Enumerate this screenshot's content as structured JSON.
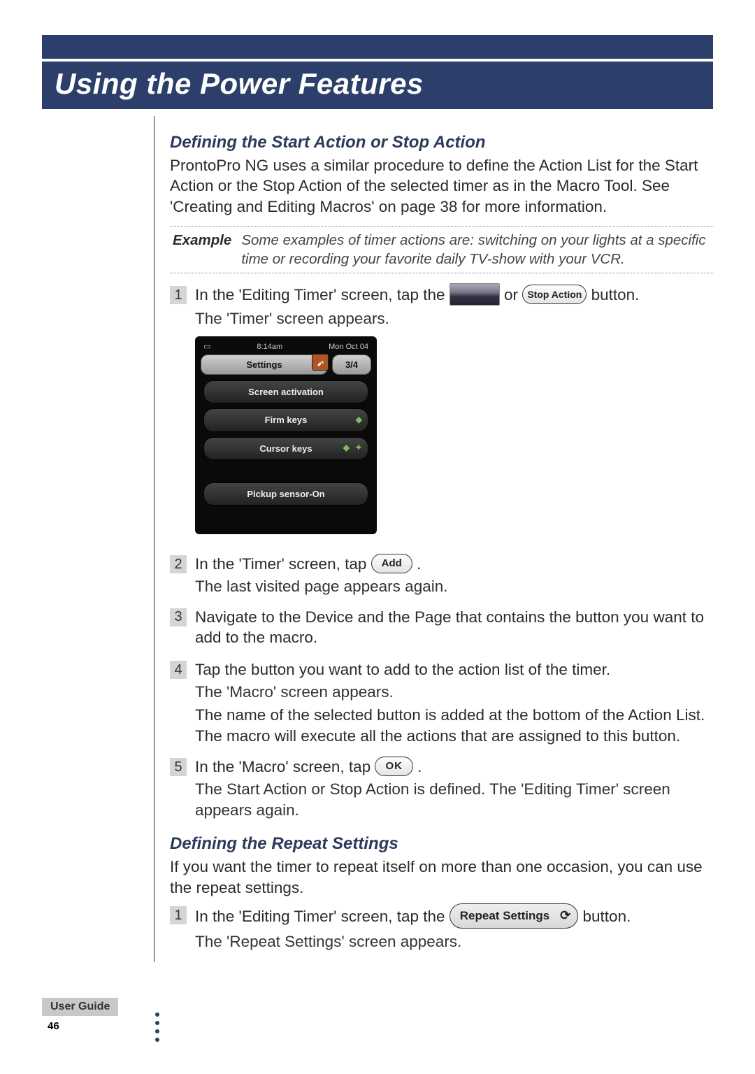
{
  "chapter_title": "Using the Power Features",
  "section1": {
    "heading": "Defining the Start Action or Stop Action",
    "intro": "ProntoPro NG uses a similar procedure to define the Action List for the Start Action or the Stop Action of the selected timer as in the Macro Tool. See 'Creating and Editing Macros' on page 38 for more information."
  },
  "example": {
    "label": "Example",
    "text": "Some examples of timer actions are: switching on your lights at a specific time or recording your favorite daily TV-show with your VCR."
  },
  "steps_a": [
    {
      "num": "1",
      "action_pre": "In the 'Editing Timer' screen, tap the ",
      "mid_or": " or ",
      "action_post": " button.",
      "stop_label": "Stop Action",
      "result": "The 'Timer' screen appears."
    },
    {
      "num": "2",
      "action_pre": "In the 'Timer' screen, tap ",
      "btn_label": "Add",
      "action_post": ".",
      "result": "The last visited page appears again."
    },
    {
      "num": "3",
      "action": "Navigate to the Device and the Page that contains the button you want to add to the macro."
    },
    {
      "num": "4",
      "action": "Tap the button you want to add to the action list of the timer.",
      "result": "The 'Macro' screen appears.",
      "followup": "The name of the selected button is added at the bottom of the Action List. The macro will execute all the actions that are assigned to this button."
    },
    {
      "num": "5",
      "action_pre": "In the 'Macro' screen, tap ",
      "btn_label": "OK",
      "action_post": ".",
      "result": "The Start Action or Stop Action is defined. The 'Editing Timer' screen appears again."
    }
  ],
  "section2": {
    "heading": "Defining the Repeat Settings",
    "intro": "If you want the timer to repeat itself on more than one occasion, you can use the repeat settings."
  },
  "steps_b": [
    {
      "num": "1",
      "action_pre": "In the 'Editing Timer' screen, tap the ",
      "btn_label": "Repeat Settings",
      "action_post": " button.",
      "result": "The 'Repeat Settings' screen appears."
    }
  ],
  "device_shot": {
    "status_left": "8:14am",
    "status_right": "Mon Oct 04",
    "tab_left": "Settings",
    "tab_right": "3/4",
    "rows": [
      "Screen activation",
      "Firm keys",
      "Cursor keys",
      "Pickup sensor-On"
    ]
  },
  "footer": {
    "guide": "User Guide",
    "page": "46"
  },
  "icons": {
    "refresh": "⟳"
  }
}
